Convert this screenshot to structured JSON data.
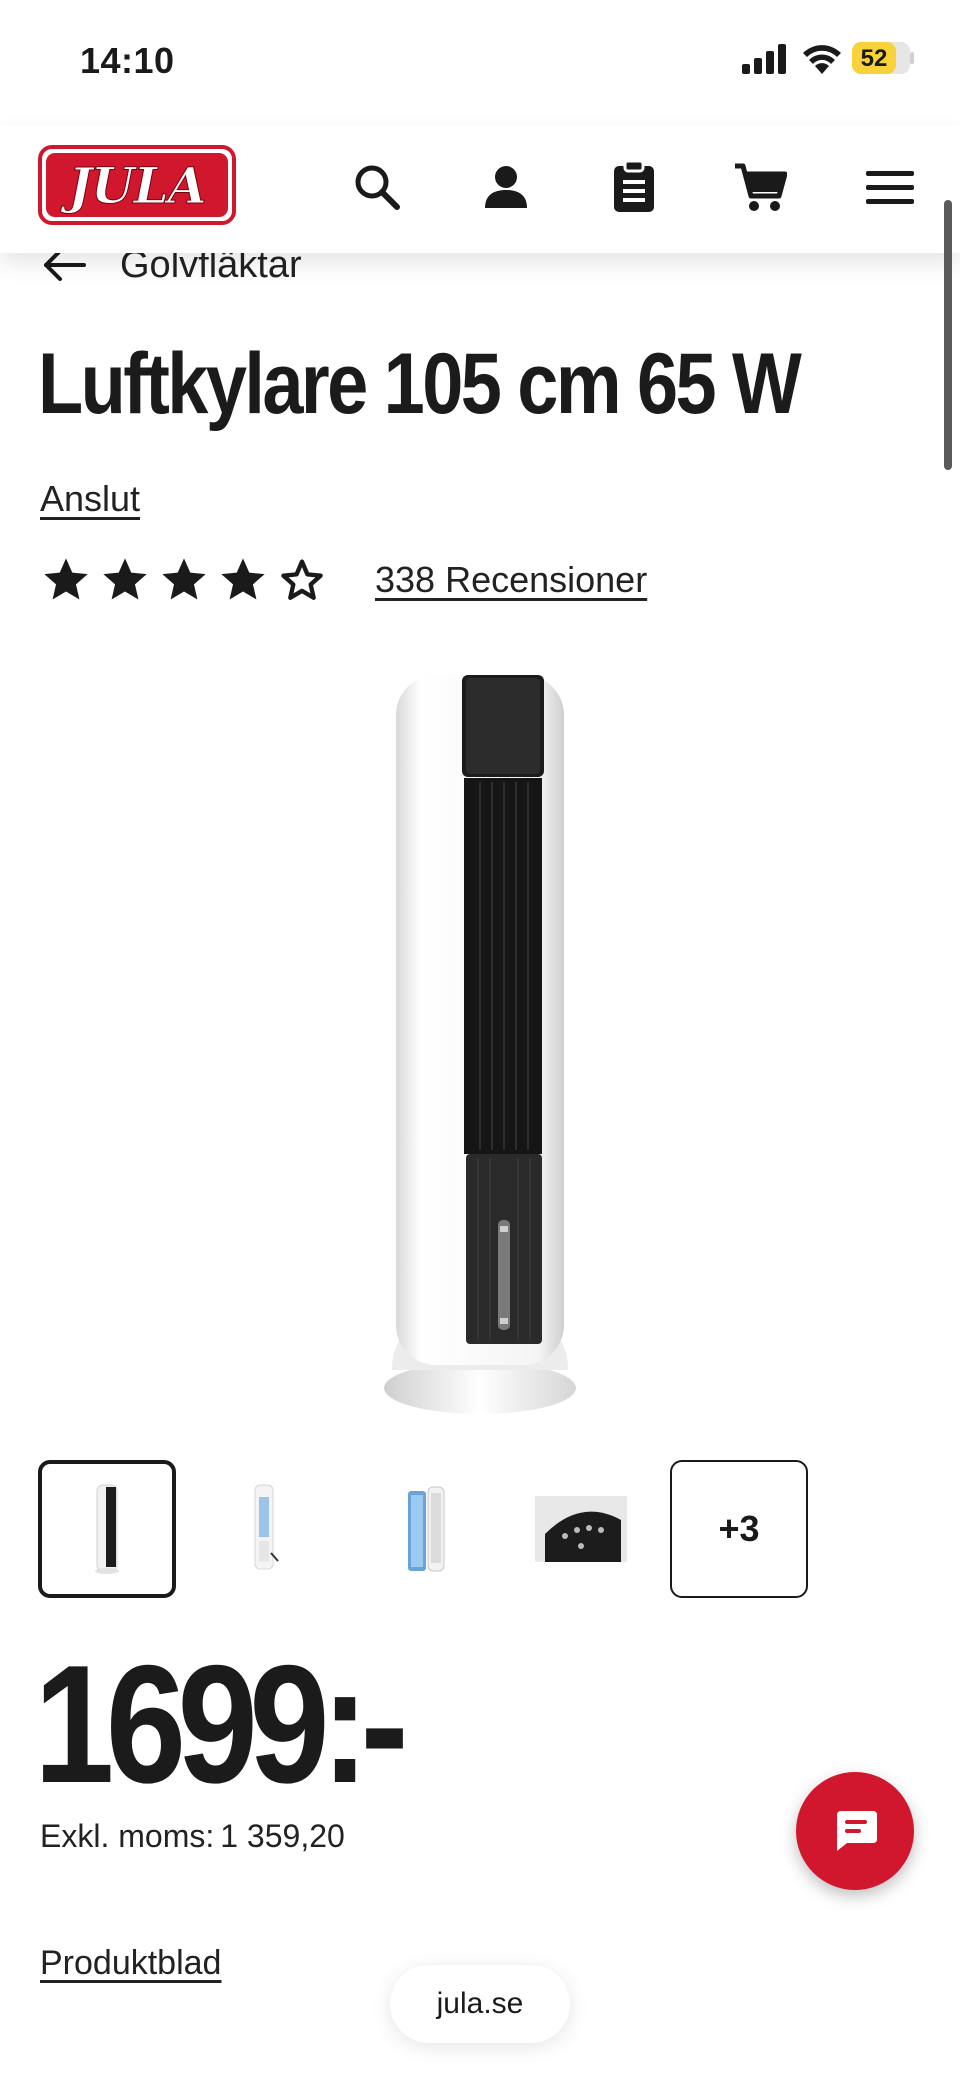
{
  "status_bar": {
    "time": "14:10",
    "battery": "52",
    "battery_color": "#f7d23a"
  },
  "header": {
    "logo_text": "JULA",
    "brand_color": "#d1172e",
    "icons": [
      "search-icon",
      "account-icon",
      "shopping-list-icon",
      "cart-icon",
      "menu-icon"
    ]
  },
  "breadcrumb": {
    "label": "Golvfläktar"
  },
  "product": {
    "title": "Luftkylare 105 cm 65 W",
    "connect_label": "Anslut",
    "rating": 4,
    "rating_max": 5,
    "reviews_label": "338 Recensioner",
    "thumbnails_more": "+3",
    "price": "1699:-",
    "excl_vat_label": "Exkl. moms:",
    "excl_vat_value": "1 359,20",
    "datasheet_label": "Produktblad"
  },
  "browser": {
    "url": "jula.se"
  }
}
